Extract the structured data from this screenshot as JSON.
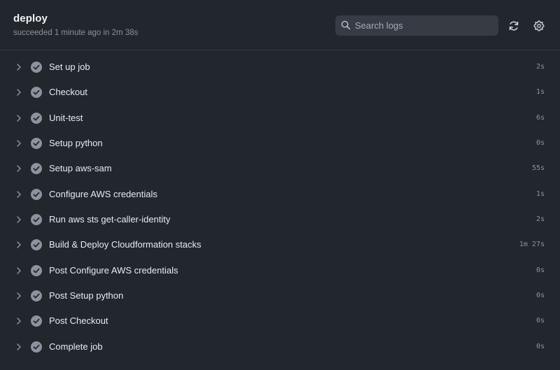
{
  "header": {
    "title": "deploy",
    "status": "succeeded 1 minute ago in 2m 38s"
  },
  "search": {
    "placeholder": "Search logs",
    "value": "",
    "icon": "search-icon"
  },
  "toolbar": {
    "refresh_icon": "refresh-icon",
    "settings_icon": "gear-icon"
  },
  "colors": {
    "background": "#22262d",
    "check": "#8b949e",
    "text": "#e6edf3",
    "muted": "#8b949e"
  },
  "steps": [
    {
      "label": "Set up job",
      "duration": "2s",
      "status": "success"
    },
    {
      "label": "Checkout",
      "duration": "1s",
      "status": "success"
    },
    {
      "label": "Unit-test",
      "duration": "6s",
      "status": "success"
    },
    {
      "label": "Setup python",
      "duration": "0s",
      "status": "success"
    },
    {
      "label": "Setup aws-sam",
      "duration": "55s",
      "status": "success"
    },
    {
      "label": "Configure AWS credentials",
      "duration": "1s",
      "status": "success"
    },
    {
      "label": "Run aws sts get-caller-identity",
      "duration": "2s",
      "status": "success"
    },
    {
      "label": "Build & Deploy Cloudformation stacks",
      "duration": "1m 27s",
      "status": "success"
    },
    {
      "label": "Post Configure AWS credentials",
      "duration": "0s",
      "status": "success"
    },
    {
      "label": "Post Setup python",
      "duration": "0s",
      "status": "success"
    },
    {
      "label": "Post Checkout",
      "duration": "0s",
      "status": "success"
    },
    {
      "label": "Complete job",
      "duration": "0s",
      "status": "success"
    }
  ]
}
